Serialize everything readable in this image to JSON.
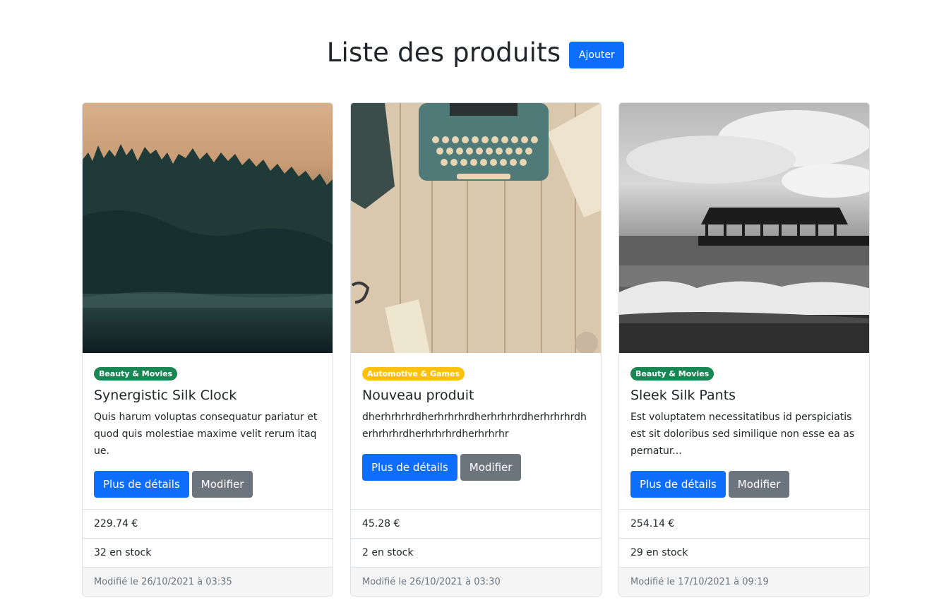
{
  "header": {
    "title": "Liste des produits",
    "add_label": "Ajouter"
  },
  "colors": {
    "primary": "#0d6efd",
    "secondary": "#6c757d",
    "success": "#198754",
    "warning": "#ffc107"
  },
  "products": [
    {
      "category": "Beauty & Movies",
      "category_color": "green",
      "name": "Synergistic Silk Clock",
      "description": "Quis harum voluptas consequatur pariatur et quod quis molestiae maxime velit rerum itaque.",
      "details_label": "Plus de détails",
      "edit_label": "Modifier",
      "price": "229.74 €",
      "stock": "32 en stock",
      "modified": "Modifié le 26/10/2021 à 03:35",
      "image": "forest-photo"
    },
    {
      "category": "Automotive & Games",
      "category_color": "yellow",
      "name": "Nouveau produit",
      "description": "dherhrhrhrdherhrhrhrdherhrhrhrdherhrhrhrdherhrhrhrdherhrhrhrdherhrhrhr",
      "details_label": "Plus de détails",
      "edit_label": "Modifier",
      "price": "45.28 €",
      "stock": "2 en stock",
      "modified": "Modifié le 26/10/2021 à 03:30",
      "image": "typewriter-photo"
    },
    {
      "category": "Beauty & Movies",
      "category_color": "green",
      "name": "Sleek Silk Pants",
      "description": "Est voluptatem necessitatibus id perspiciatis est sit doloribus sed similique non esse ea aspernatur...",
      "details_label": "Plus de détails",
      "edit_label": "Modifier",
      "price": "254.14 €",
      "stock": "29 en stock",
      "modified": "Modifié le 17/10/2021 à 09:19",
      "image": "pier-photo"
    }
  ]
}
